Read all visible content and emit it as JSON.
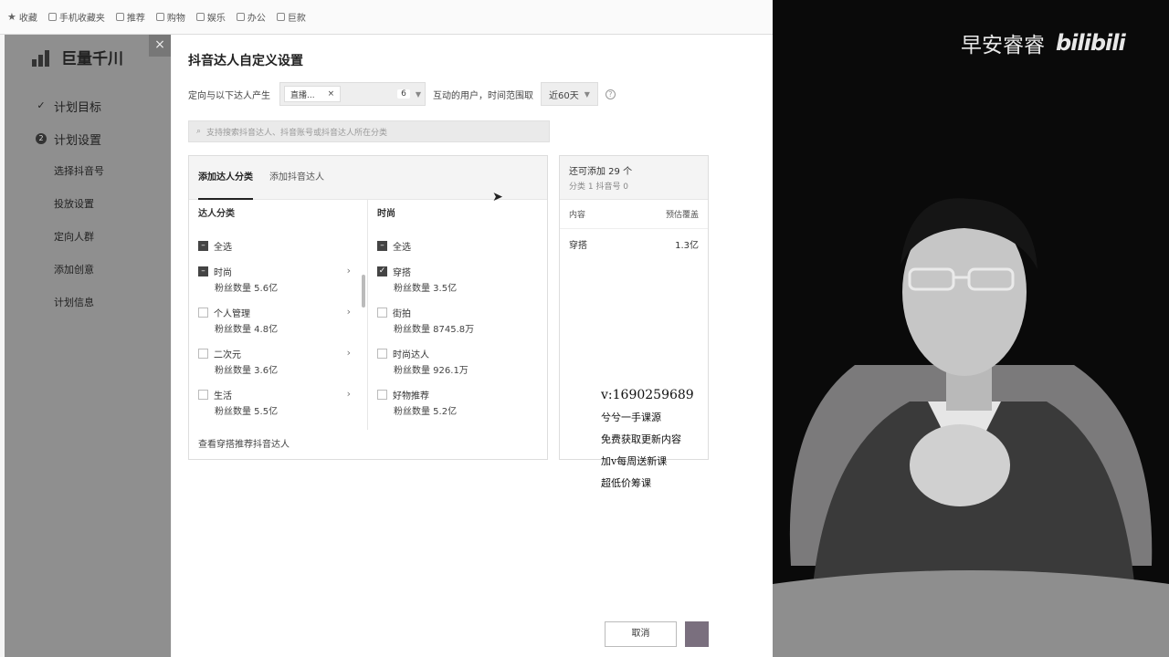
{
  "bookmarks": [
    {
      "label": "收藏",
      "icon": "star-icon"
    },
    {
      "label": "手机收藏夹",
      "icon": "phone-icon"
    },
    {
      "label": "推荐",
      "icon": "folder-icon"
    },
    {
      "label": "购物",
      "icon": "folder-icon"
    },
    {
      "label": "娱乐",
      "icon": "folder-icon"
    },
    {
      "label": "办公",
      "icon": "folder-icon"
    },
    {
      "label": "巨款",
      "icon": "folder-icon"
    }
  ],
  "sidebar": {
    "logo": "巨量千川",
    "main_items": [
      {
        "label": "计划目标",
        "icon": "check-icon"
      },
      {
        "label": "计划设置",
        "icon": "step-circle-icon"
      }
    ],
    "sub_items": [
      "选择抖音号",
      "投放设置",
      "定向人群",
      "添加创意",
      "计划信息"
    ]
  },
  "dialog": {
    "title": "抖音达人自定义设置",
    "filter": {
      "prefix": "定向与以下达人产生",
      "chip": "直播...",
      "count": "6",
      "middle": "互动的用户，时间范围取",
      "range": "近60天"
    },
    "search_placeholder": "支持搜索抖音达人、抖音账号或抖音达人所在分类",
    "tabs": [
      "添加达人分类",
      "添加抖音达人"
    ],
    "left_column": {
      "header": "达人分类",
      "select_all": "全选",
      "items": [
        {
          "name": "时尚",
          "fans": "粉丝数量 5.6亿"
        },
        {
          "name": "个人管理",
          "fans": "粉丝数量 4.8亿"
        },
        {
          "name": "二次元",
          "fans": "粉丝数量 3.6亿"
        },
        {
          "name": "生活",
          "fans": "粉丝数量 5.5亿"
        }
      ]
    },
    "right_column": {
      "header": "时尚",
      "select_all": "全选",
      "items": [
        {
          "name": "穿搭",
          "fans": "粉丝数量 3.5亿"
        },
        {
          "name": "街拍",
          "fans": "粉丝数量 8745.8万"
        },
        {
          "name": "时尚达人",
          "fans": "粉丝数量 926.1万"
        },
        {
          "name": "好物推荐",
          "fans": "粉丝数量 5.2亿"
        }
      ]
    },
    "recommend_link": "查看穿搭推荐抖音达人",
    "summary": {
      "title": "还可添加 29 个",
      "subtitle": "分类 1 抖音号 0",
      "col_content": "内容",
      "col_coverage": "预估覆盖",
      "rows": [
        {
          "content": "穿搭",
          "coverage": "1.3亿"
        }
      ]
    },
    "cancel_label": "取消",
    "close_glyph": "×"
  },
  "promo": {
    "contact": "v:1690259689",
    "lines": [
      "兮兮一手课源",
      "免费获取更新内容",
      "加v每周送新课",
      "超低价筹课"
    ]
  },
  "watermark": {
    "name": "早安睿睿",
    "brand": "bilibili"
  },
  "colors": {
    "sidebar_bg": "#8f8f8f",
    "dialog_bg": "#ffffff",
    "confirm_btn": "#7a6f7e",
    "video_bg": "#0a0a0a"
  }
}
